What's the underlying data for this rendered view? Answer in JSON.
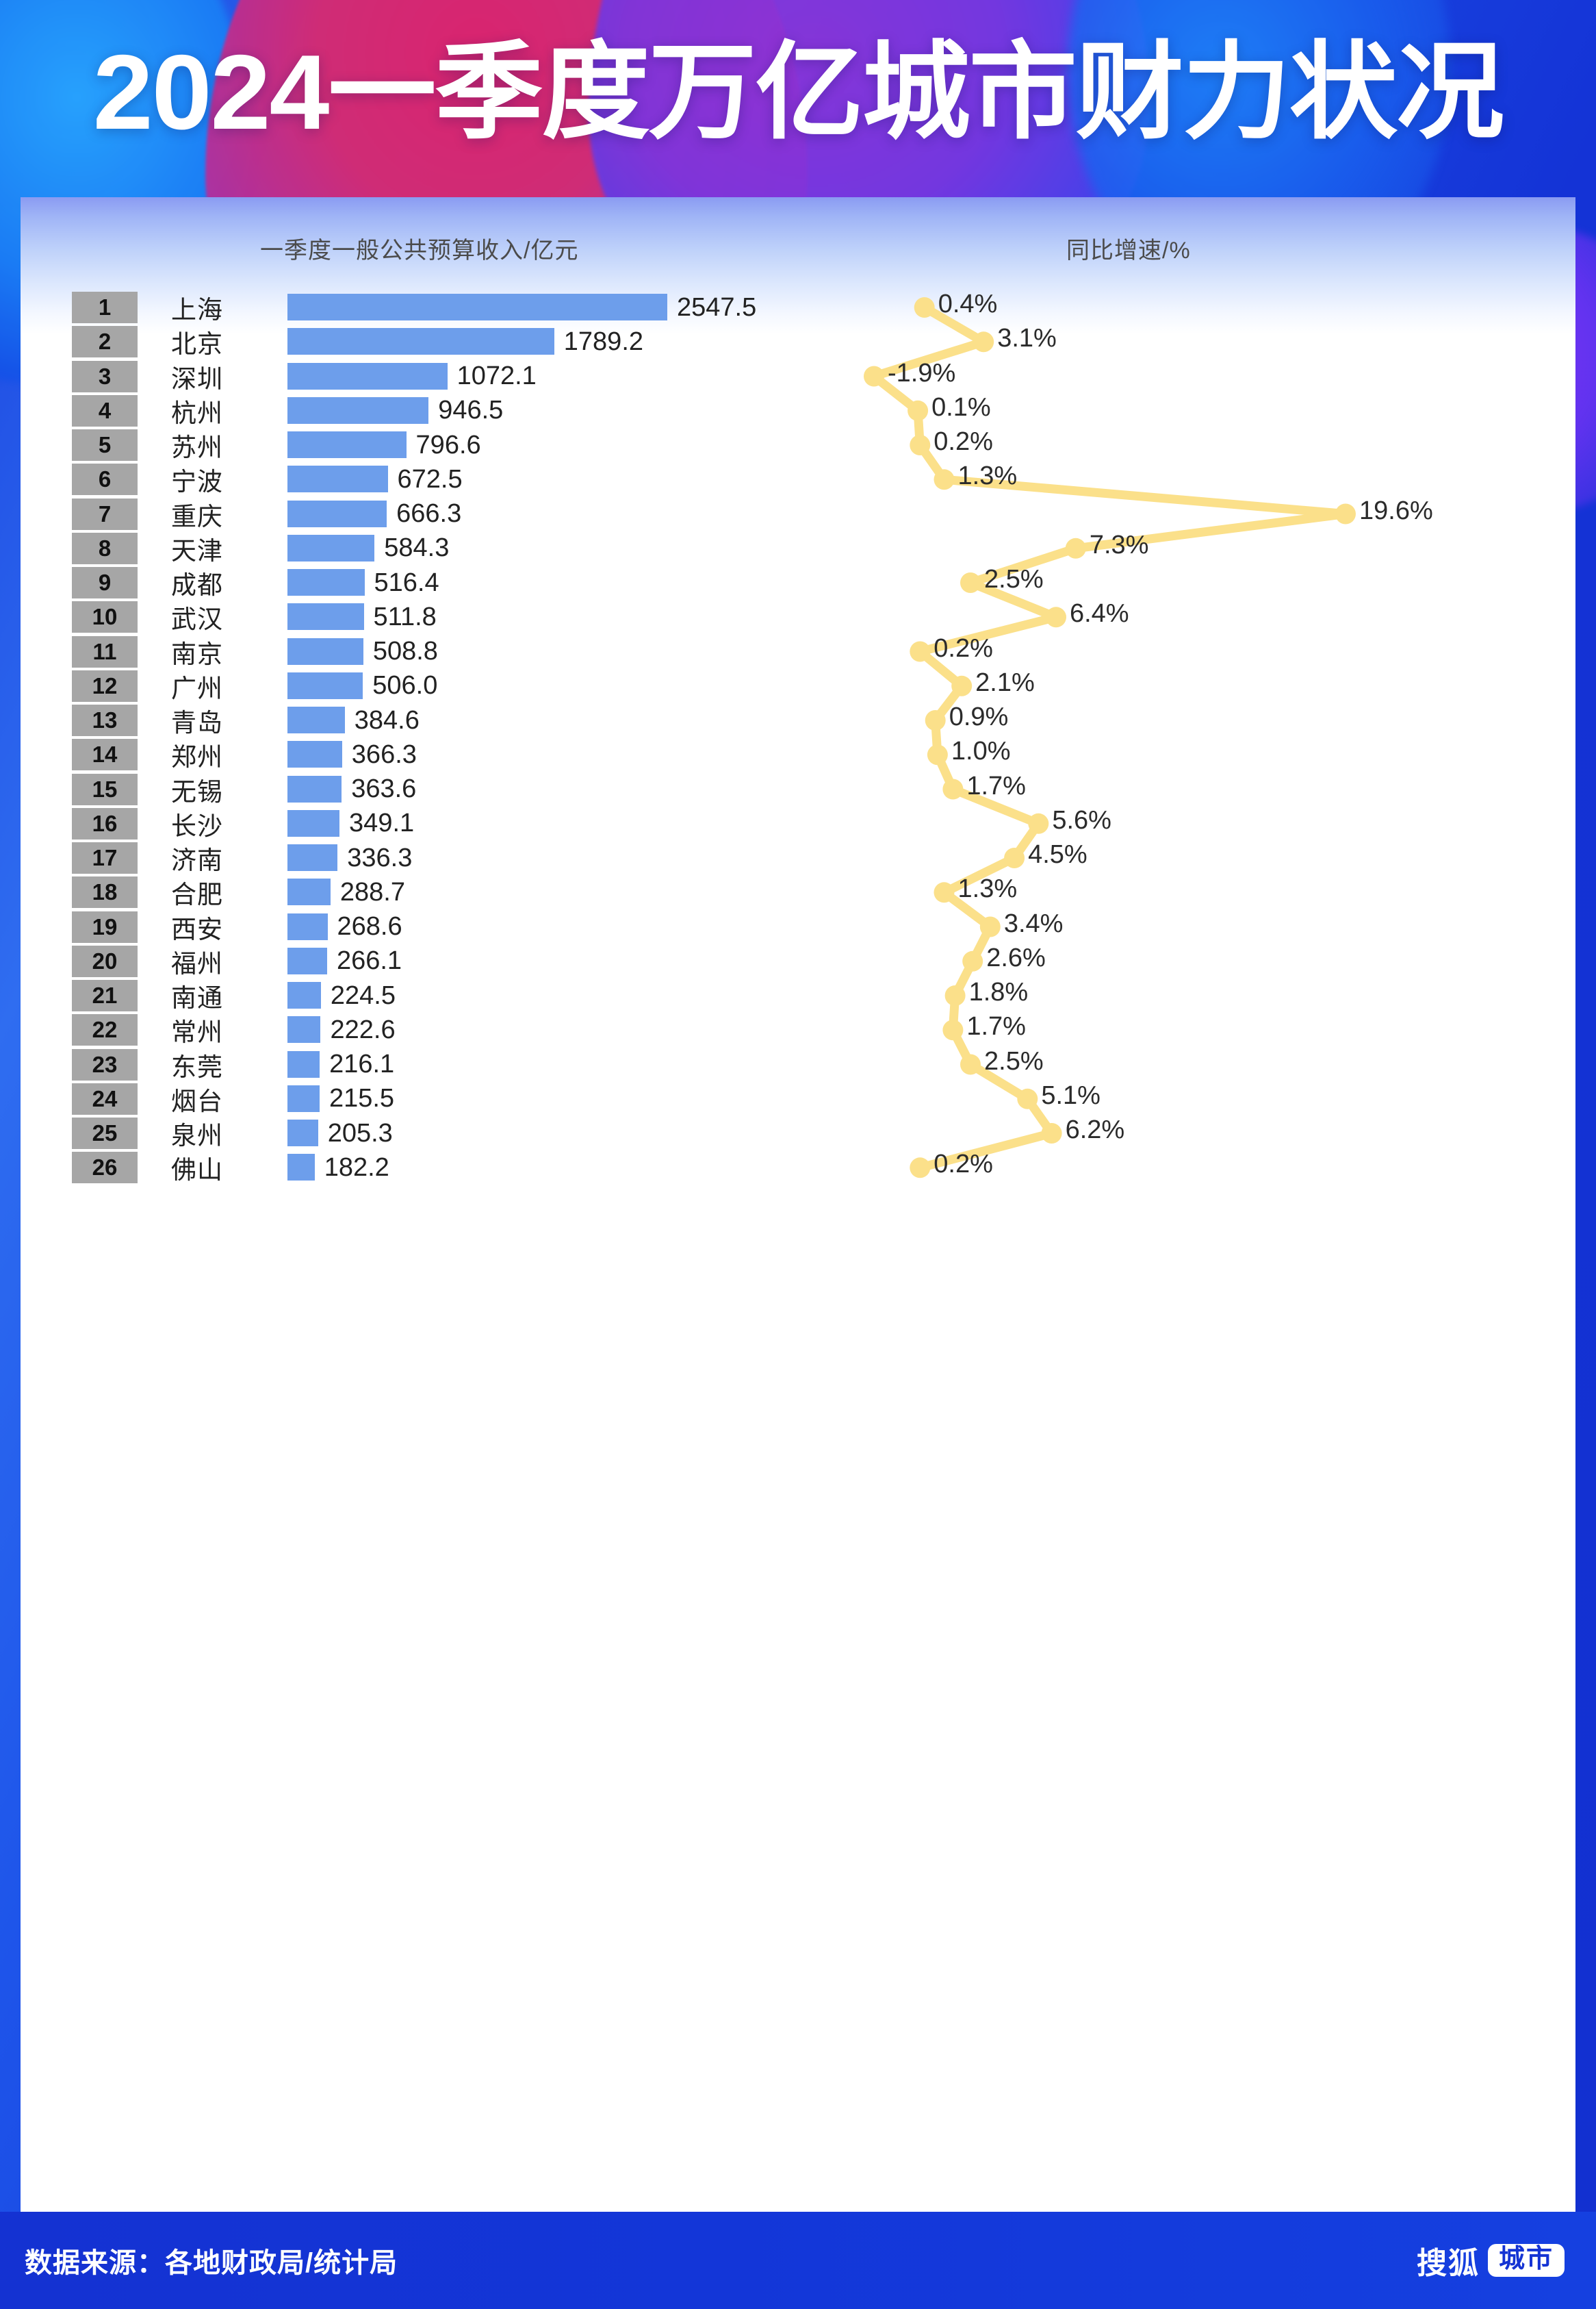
{
  "header": {
    "title": "2024一季度万亿城市财力状况"
  },
  "columns": {
    "left_header": "一季度一般公共预算收入/亿元",
    "right_header": "同比增速/%"
  },
  "footer": {
    "source": "数据来源：各地财政局/统计局",
    "brand_name": "搜狐",
    "brand_tag": "城市"
  },
  "colors": {
    "bar": "#6d9eeb",
    "line": "#fbe08a",
    "rank_badge": "#a6a6a6",
    "header_blue": "#1433d4",
    "panel": "#ffffff"
  },
  "chart_data": {
    "type": "bar",
    "title": "2024一季度万亿城市财力状况",
    "xlabel": "",
    "ylabel": "",
    "grid": false,
    "legend": "none",
    "categories": [
      "上海",
      "北京",
      "深圳",
      "杭州",
      "苏州",
      "宁波",
      "重庆",
      "天津",
      "成都",
      "武汉",
      "南京",
      "广州",
      "青岛",
      "郑州",
      "无锡",
      "长沙",
      "济南",
      "合肥",
      "西安",
      "福州",
      "南通",
      "常州",
      "东莞",
      "烟台",
      "泉州",
      "佛山"
    ],
    "ranks": [
      1,
      2,
      3,
      4,
      5,
      6,
      7,
      8,
      9,
      10,
      11,
      12,
      13,
      14,
      15,
      16,
      17,
      18,
      19,
      20,
      21,
      22,
      23,
      24,
      25,
      26
    ],
    "series": [
      {
        "name": "一季度一般公共预算收入/亿元",
        "type": "bar",
        "unit": "亿元",
        "values": [
          2547.5,
          1789.2,
          1072.1,
          946.5,
          796.6,
          672.5,
          666.3,
          584.3,
          516.4,
          511.8,
          508.8,
          506.0,
          384.6,
          366.3,
          363.6,
          349.1,
          336.3,
          288.7,
          268.6,
          266.1,
          224.5,
          222.6,
          216.1,
          215.5,
          205.3,
          182.2
        ],
        "labels": [
          "2547.5",
          "1789.2",
          "1072.1",
          "946.5",
          "796.6",
          "672.5",
          "666.3",
          "584.3",
          "516.4",
          "511.8",
          "508.8",
          "506.0",
          "384.6",
          "366.3",
          "363.6",
          "349.1",
          "336.3",
          "288.7",
          "268.6",
          "266.1",
          "224.5",
          "222.6",
          "216.1",
          "215.5",
          "205.3",
          "182.2"
        ]
      },
      {
        "name": "同比增速/%",
        "type": "line",
        "unit": "%",
        "values": [
          0.4,
          3.1,
          -1.9,
          0.1,
          0.2,
          1.3,
          19.6,
          7.3,
          2.5,
          6.4,
          0.2,
          2.1,
          0.9,
          1.0,
          1.7,
          5.6,
          4.5,
          1.3,
          3.4,
          2.6,
          1.8,
          1.7,
          2.5,
          5.1,
          6.2,
          0.2
        ],
        "labels": [
          "0.4%",
          "3.1%",
          "-1.9%",
          "0.1%",
          "0.2%",
          "1.3%",
          "19.6%",
          "7.3%",
          "2.5%",
          "6.4%",
          "0.2%",
          "2.1%",
          "0.9%",
          "1.0%",
          "1.7%",
          "5.6%",
          "4.5%",
          "1.3%",
          "3.4%",
          "2.6%",
          "1.8%",
          "1.7%",
          "2.5%",
          "5.1%",
          "6.2%",
          "0.2%"
        ]
      }
    ],
    "bar_max": 2547.5,
    "line_range": [
      -1.9,
      19.6
    ]
  }
}
